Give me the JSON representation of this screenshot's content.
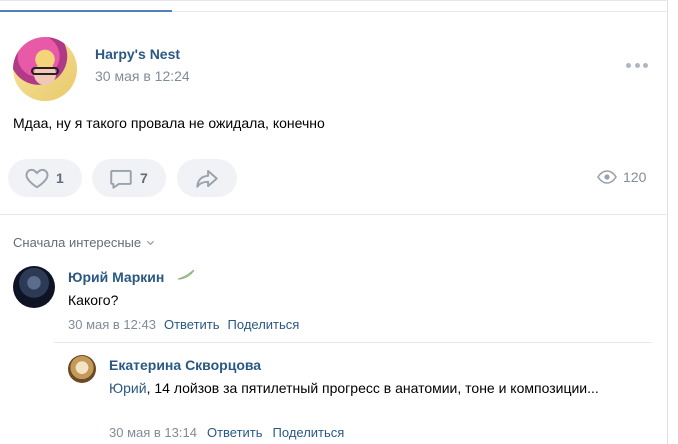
{
  "post": {
    "author": "Harpy's Nest",
    "date": "30 мая в 12:24",
    "text": "Мдаа, ну я такого провала не ожидала, конечно",
    "likes": "1",
    "comments": "7",
    "views": "120"
  },
  "comments_sort": "Сначала интересные",
  "comments": [
    {
      "author": "Юрий Маркин",
      "text": "Какого?",
      "date": "30 мая в 12:43",
      "reply_label": "Ответить",
      "share_label": "Поделиться"
    },
    {
      "author": "Екатерина Скворцова",
      "mention": "Юрий",
      "text": ", 14 лойзов за пятилетный прогресс в анатомии, тоне и композиции...",
      "date": "30 мая в 13:14",
      "reply_label": "Ответить",
      "share_label": "Поделиться"
    }
  ],
  "colors": {
    "link": "#2a5885",
    "muted": "#818c99",
    "pill_bg": "#f0f2f5",
    "accent": "#5181b8"
  }
}
